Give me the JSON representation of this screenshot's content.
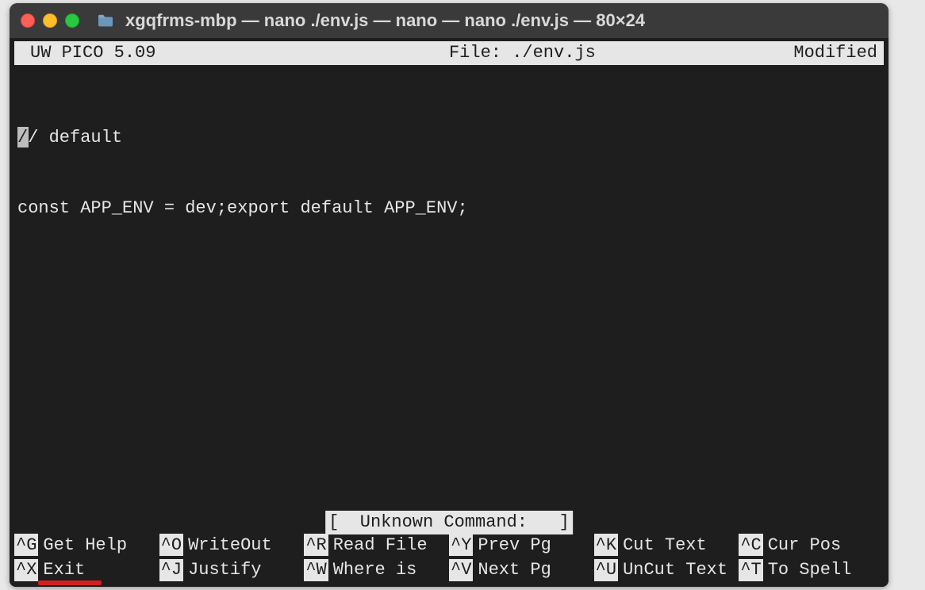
{
  "window": {
    "title": "xgqfrms-mbp — nano ./env.js — nano — nano ./env.js — 80×24"
  },
  "status": {
    "app": "UW PICO 5.09",
    "file_label": "File: ./env.js",
    "modified": "Modified"
  },
  "editor": {
    "lines": [
      "// default",
      "const APP_ENV = dev;export default APP_ENV;"
    ],
    "first_char": "/"
  },
  "message": "[  Unknown Command:   ]",
  "shortcuts": {
    "row1": [
      {
        "key": "^G",
        "label": "Get Help"
      },
      {
        "key": "^O",
        "label": "WriteOut"
      },
      {
        "key": "^R",
        "label": "Read File"
      },
      {
        "key": "^Y",
        "label": "Prev Pg"
      },
      {
        "key": "^K",
        "label": "Cut Text"
      },
      {
        "key": "^C",
        "label": "Cur Pos"
      }
    ],
    "row2": [
      {
        "key": "^X",
        "label": "Exit"
      },
      {
        "key": "^J",
        "label": "Justify"
      },
      {
        "key": "^W",
        "label": "Where is"
      },
      {
        "key": "^V",
        "label": "Next Pg"
      },
      {
        "key": "^U",
        "label": "UnCut Text"
      },
      {
        "key": "^T",
        "label": "To Spell"
      }
    ]
  }
}
